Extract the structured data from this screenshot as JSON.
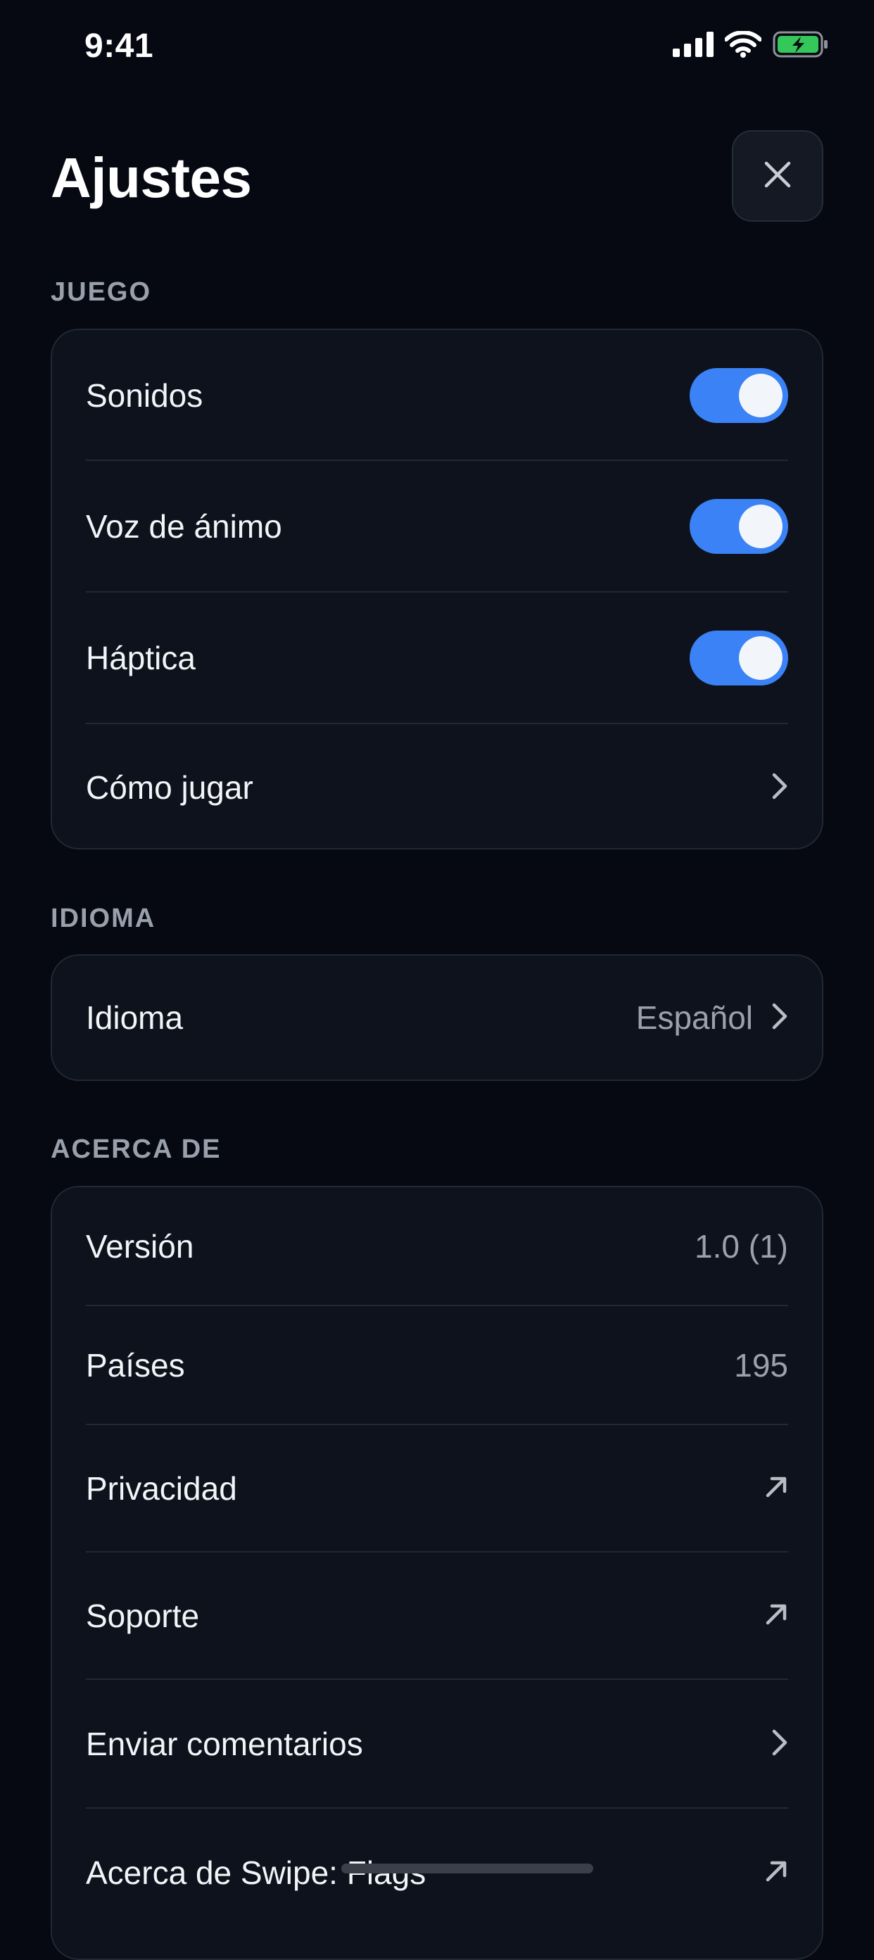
{
  "status_bar": {
    "time": "9:41",
    "icons": [
      "signal-icon",
      "wifi-icon",
      "battery-charging-icon"
    ],
    "battery_color": "#34c759"
  },
  "header": {
    "title": "Ajustes",
    "close_icon": "close-icon"
  },
  "sections": {
    "game": {
      "title": "JUEGO",
      "rows": {
        "sounds": {
          "label": "Sonidos",
          "on": true
        },
        "voice": {
          "label": "Voz de ánimo",
          "on": true
        },
        "haptics": {
          "label": "Háptica",
          "on": true
        },
        "how_to_play": {
          "label": "Cómo jugar",
          "icon": "chevron-right-icon"
        }
      }
    },
    "language": {
      "title": "IDIOMA",
      "rows": {
        "language": {
          "label": "Idioma",
          "value": "Español",
          "icon": "chevron-right-icon"
        }
      }
    },
    "about": {
      "title": "ACERCA DE",
      "rows": {
        "version": {
          "label": "Versión",
          "value": "1.0 (1)"
        },
        "countries": {
          "label": "Países",
          "value": "195"
        },
        "privacy": {
          "label": "Privacidad",
          "icon": "external-link-icon"
        },
        "support": {
          "label": "Soporte",
          "icon": "external-link-icon"
        },
        "feedback": {
          "label": "Enviar comentarios",
          "icon": "chevron-right-icon"
        },
        "about_app": {
          "label": "Acerca de Swipe: Flags",
          "icon": "external-link-icon"
        }
      }
    }
  },
  "colors": {
    "background": "#060912",
    "card": "#0e121c",
    "accent": "#3a82f6",
    "secondary_text": "#9ba1ac"
  }
}
